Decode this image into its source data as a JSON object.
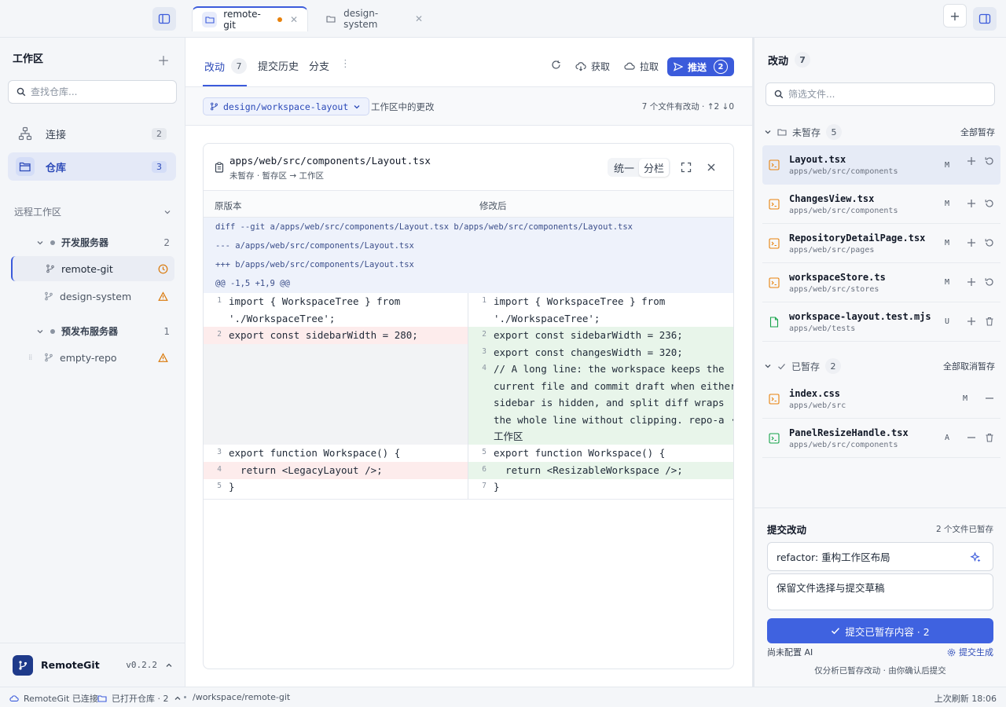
{
  "titlebar": {
    "tabs": [
      {
        "label": "remote-git",
        "modified": true
      },
      {
        "label": "design-system",
        "modified": false
      }
    ]
  },
  "sidebar": {
    "title": "工作区",
    "search_placeholder": "查找仓库...",
    "nav": [
      {
        "label": "连接",
        "count": "2"
      },
      {
        "label": "仓库",
        "count": "3"
      }
    ],
    "remote_section": "远程工作区",
    "servers": [
      {
        "name": "开发服务器",
        "count": "2",
        "repos": [
          {
            "name": "remote-git",
            "status": "clock"
          },
          {
            "name": "design-system",
            "status": "warning"
          }
        ]
      },
      {
        "name": "预发布服务器",
        "count": "1",
        "repos": [
          {
            "name": "empty-repo",
            "status": "warning"
          }
        ]
      }
    ],
    "app_name": "RemoteGit",
    "version": "v0.2.2"
  },
  "main": {
    "tabs": [
      {
        "label": "改动",
        "count": "7"
      },
      {
        "label": "提交历史"
      },
      {
        "label": "分支"
      }
    ],
    "actions": {
      "fetch": "获取",
      "pull": "拉取",
      "push": "推送",
      "push_count": "2"
    },
    "branch": "design/workspace-layout",
    "branch_desc": "工作区中的更改",
    "summary": "7 个文件有改动 · ↑2 ↓0",
    "diff": {
      "file_path": "apps/web/src/components/Layout.tsx",
      "sub": "未暂存 · 暂存区 → 工作区",
      "mode_unified": "统一",
      "mode_split": "分栏",
      "col_left": "原版本",
      "col_right": "修改后",
      "meta": [
        "diff --git a/apps/web/src/components/Layout.tsx b/apps/web/src/components/Layout.tsx",
        "--- a/apps/web/src/components/Layout.tsx",
        "+++ b/apps/web/src/components/Layout.tsx",
        "@@ -1,5 +1,9 @@"
      ],
      "left": [
        {
          "n": "1",
          "t": "import { WorkspaceTree } from"
        },
        {
          "n": "",
          "t": "'./WorkspaceTree';"
        },
        {
          "n": "2",
          "t": "export const sidebarWidth = 280;"
        },
        {
          "n": "3",
          "t": "export function Workspace() {"
        },
        {
          "n": "4",
          "t": "  return <LegacyLayout />;"
        },
        {
          "n": "5",
          "t": "}"
        }
      ],
      "right": [
        {
          "n": "1",
          "t": "import { WorkspaceTree } from"
        },
        {
          "n": "",
          "t": "'./WorkspaceTree';"
        },
        {
          "n": "2",
          "t": "export const sidebarWidth = 236;"
        },
        {
          "n": "3",
          "t": "export const changesWidth = 320;"
        },
        {
          "n": "4",
          "t": "// A long line: the workspace keeps the"
        },
        {
          "n": "",
          "t": "current file and commit draft when either"
        },
        {
          "n": "",
          "t": "sidebar is hidden, and split diff wraps"
        },
        {
          "n": "",
          "t": "the whole line without clipping. repo-a ·"
        },
        {
          "n": "",
          "t": "工作区"
        },
        {
          "n": "5",
          "t": "export function Workspace() {"
        },
        {
          "n": "6",
          "t": "  return <ResizableWorkspace />;"
        },
        {
          "n": "7",
          "t": "}"
        }
      ]
    }
  },
  "changes": {
    "title": "改动",
    "count": "7",
    "filter_placeholder": "筛选文件...",
    "unstaged": {
      "label": "未暂存",
      "count": "5",
      "action": "全部暂存",
      "files": [
        {
          "name": "Layout.tsx",
          "path": "apps/web/src/components",
          "status": "M"
        },
        {
          "name": "ChangesView.tsx",
          "path": "apps/web/src/components",
          "status": "M"
        },
        {
          "name": "RepositoryDetailPage.tsx",
          "path": "apps/web/src/pages",
          "status": "M"
        },
        {
          "name": "workspaceStore.ts",
          "path": "apps/web/src/stores",
          "status": "M"
        },
        {
          "name": "workspace-layout.test.mjs",
          "path": "apps/web/tests",
          "status": "U"
        }
      ]
    },
    "staged": {
      "label": "已暂存",
      "count": "2",
      "action": "全部取消暂存",
      "files": [
        {
          "name": "index.css",
          "path": "apps/web/src",
          "status": "M"
        },
        {
          "name": "PanelResizeHandle.tsx",
          "path": "apps/web/src/components",
          "status": "A"
        }
      ]
    },
    "commit": {
      "title": "提交改动",
      "staged_info": "2 个文件已暂存",
      "summary": "refactor: 重构工作区布局",
      "body": "保留文件选择与提交草稿",
      "button": "提交已暂存内容 · 2",
      "ai_status": "尚未配置 AI",
      "ai_link": "提交生成",
      "note": "仅分析已暂存改动 · 由你确认后提交"
    }
  },
  "status": {
    "connected": "RemoteGit 已连接",
    "open_repos": "已打开仓库 · 2",
    "path": "/workspace/remote-git",
    "refresh": "上次刷新 18:06"
  }
}
